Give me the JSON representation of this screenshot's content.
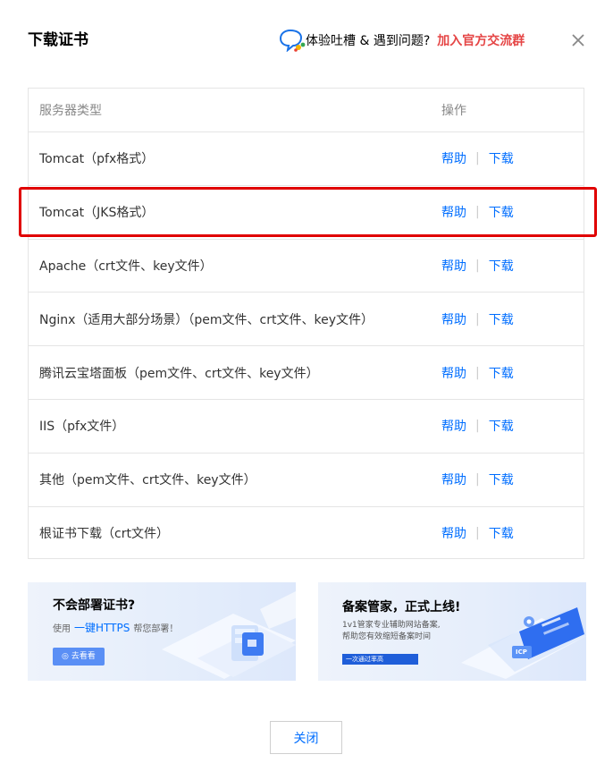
{
  "dialog": {
    "title": "下载证书",
    "feedback_text": "体验吐槽 & 遇到问题?",
    "feedback_link": "加入官方交流群",
    "close_label": "关闭"
  },
  "table": {
    "header": {
      "name": "服务器类型",
      "op": "操作"
    },
    "help_label": "帮助",
    "download_label": "下载",
    "separator": "|",
    "rows": [
      {
        "name": "Tomcat（pfx格式）"
      },
      {
        "name": "Tomcat（JKS格式）"
      },
      {
        "name": "Apache（crt文件、key文件）"
      },
      {
        "name": "Nginx（适用大部分场景）（pem文件、crt文件、key文件）"
      },
      {
        "name": "腾讯云宝塔面板（pem文件、crt文件、key文件）"
      },
      {
        "name": "IIS（pfx文件）"
      },
      {
        "name": "其他（pem文件、crt文件、key文件）"
      },
      {
        "name": "根证书下载（crt文件）"
      }
    ]
  },
  "banners": {
    "left": {
      "title": "不会部署证书?",
      "sub_prefix": "使用",
      "sub_highlight": "一键HTTPS",
      "sub_suffix": "帮您部署！",
      "button": "去看看"
    },
    "right": {
      "title": "备案管家，正式上线!",
      "desc_line1": "1v1管家专业辅助网站备案,",
      "desc_line2": "帮助您有效缩短备案时间",
      "button": "一次通过率高",
      "badge": "ICP"
    }
  },
  "colors": {
    "link": "#006eff",
    "accent_red": "#e54545",
    "highlight": "#e00000"
  }
}
